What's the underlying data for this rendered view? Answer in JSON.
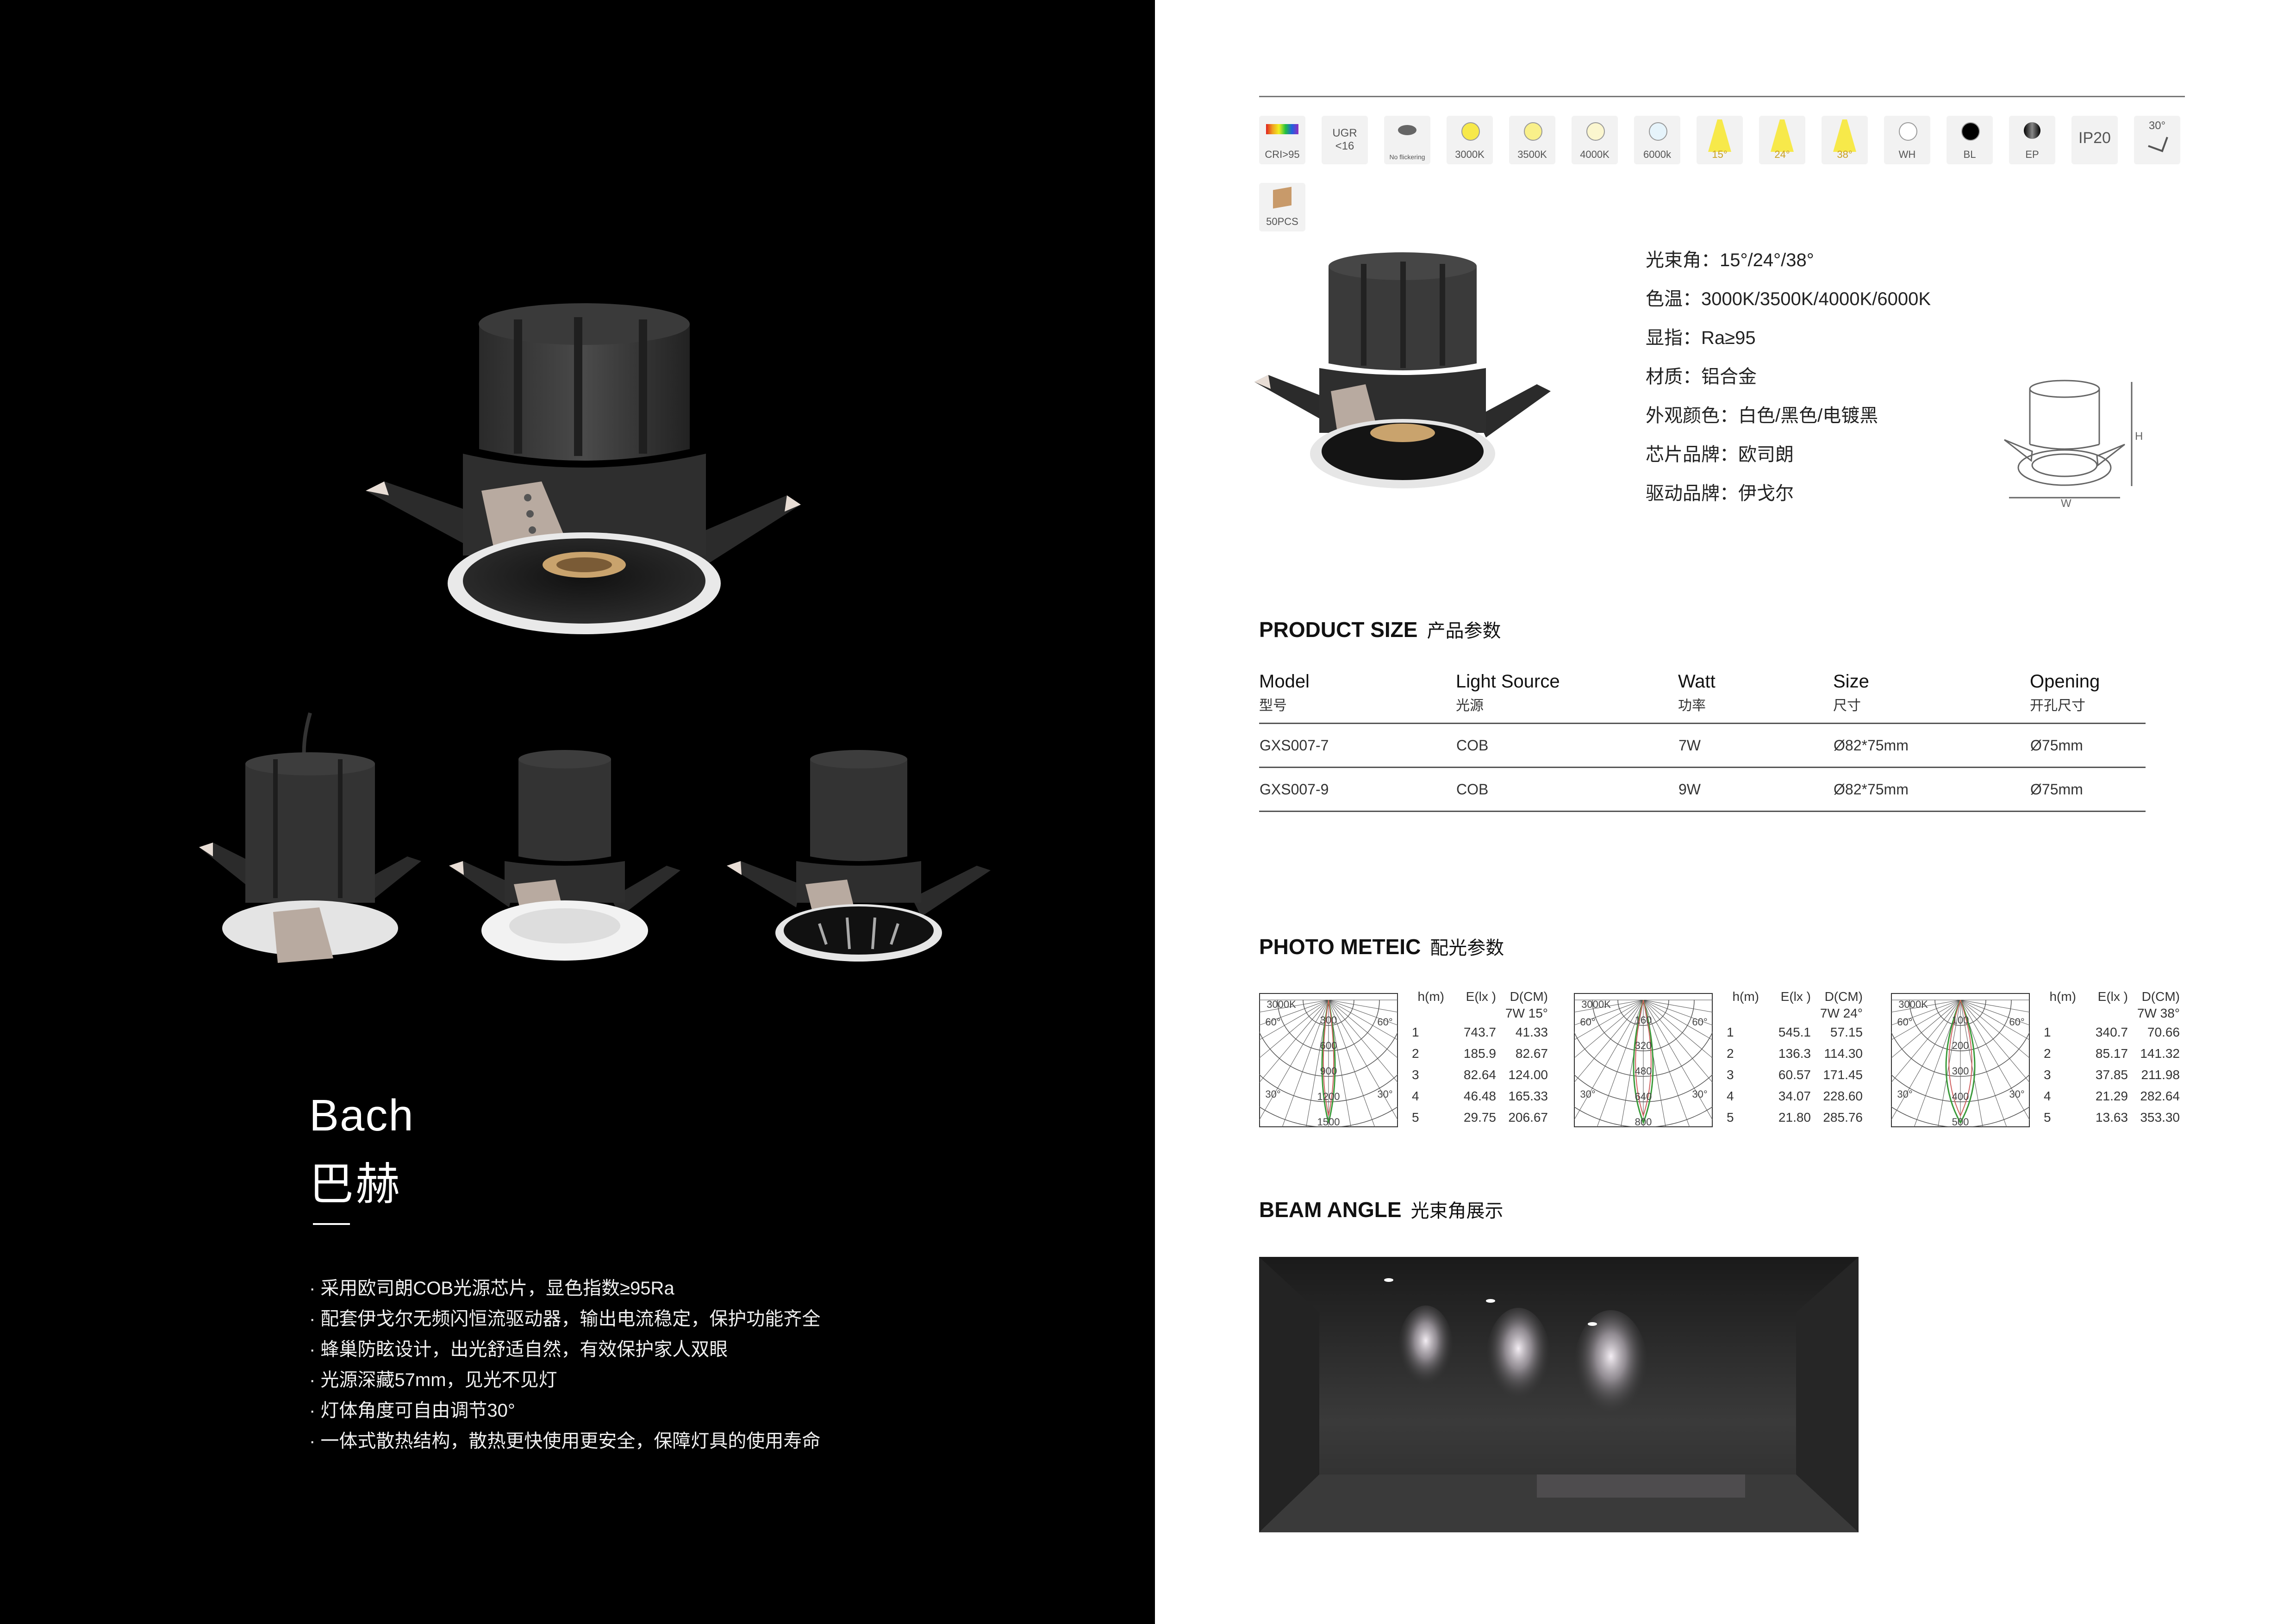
{
  "product": {
    "name_en": "Bach",
    "name_cn": "巴赫",
    "features": [
      "· 采用欧司朗COB光源芯片，显色指数≥95Ra",
      "· 配套伊戈尔无频闪恒流驱动器，输出电流稳定，保护功能齐全",
      "· 蜂巢防眩设计，出光舒适自然，有效保护家人双眼",
      "· 光源深藏57mm，见光不见灯",
      "· 灯体角度可自由调节30°",
      "· 一体式散热结构，散热更快使用更安全，保障灯具的使用寿命"
    ]
  },
  "icons": [
    {
      "name": "cri-icon",
      "label": "CRI>95",
      "type": "cri"
    },
    {
      "name": "ugr-icon",
      "label": "UGR\n<16",
      "type": "text"
    },
    {
      "name": "no-flicker-icon",
      "label": "No flickering",
      "type": "eye"
    },
    {
      "name": "cct-3000k-icon",
      "label": "3000K",
      "type": "dot",
      "color": "#f7e94a"
    },
    {
      "name": "cct-3500k-icon",
      "label": "3500K",
      "type": "dot",
      "color": "#f9f08a"
    },
    {
      "name": "cct-4000k-icon",
      "label": "4000K",
      "type": "dot",
      "color": "#fbf6cf"
    },
    {
      "name": "cct-6000k-icon",
      "label": "6000k",
      "type": "dot",
      "color": "#e6f4fb"
    },
    {
      "name": "beam-15-icon",
      "label": "15°",
      "type": "beam",
      "color": "#f7e94a"
    },
    {
      "name": "beam-24-icon",
      "label": "24°",
      "type": "beam",
      "color": "#f7e94a"
    },
    {
      "name": "beam-38-icon",
      "label": "38°",
      "type": "beam",
      "color": "#f7e94a"
    },
    {
      "name": "color-white-icon",
      "label": "WH",
      "type": "dot",
      "color": "#ffffff"
    },
    {
      "name": "color-black-icon",
      "label": "BL",
      "type": "dot",
      "color": "#000000"
    },
    {
      "name": "color-ep-icon",
      "label": "EP",
      "type": "ep"
    },
    {
      "name": "ip20-icon",
      "label": "IP20",
      "type": "text"
    },
    {
      "name": "tilt-30-icon",
      "label": "30°",
      "type": "tilt"
    },
    {
      "name": "box-50pcs-icon",
      "label": "50PCS",
      "type": "box"
    }
  ],
  "specs": [
    "光束角：15°/24°/38°",
    "色温：3000K/3500K/4000K/6000K",
    "显指：Ra≥95",
    "材质：铝合金",
    "外观颜色：白色/黑色/电镀黑",
    "芯片品牌：欧司朗",
    "驱动品牌：伊戈尔"
  ],
  "dimension_labels": {
    "height": "H",
    "width": "W"
  },
  "product_size": {
    "title": "PRODUCT SIZE",
    "title_cn": "产品参数",
    "columns": [
      {
        "en": "Model",
        "cn": "型号"
      },
      {
        "en": "Light Source",
        "cn": "光源"
      },
      {
        "en": "Watt",
        "cn": "功率"
      },
      {
        "en": "Size",
        "cn": "尺寸"
      },
      {
        "en": "Opening",
        "cn": "开孔尺寸"
      }
    ],
    "rows": [
      [
        "GXS007-7",
        "COB",
        "7W",
        "Ø82*75mm",
        "Ø75mm"
      ],
      [
        "GXS007-9",
        "COB",
        "9W",
        "Ø82*75mm",
        "Ø75mm"
      ]
    ]
  },
  "photometric": {
    "title": "PHOTO METEIC",
    "title_cn": "配光参数",
    "headers": [
      "h(m)",
      "E(lx )",
      "D(CM)"
    ],
    "diagrams": [
      {
        "cct": "3000K",
        "spec": "7W  15°",
        "rings": [
          "300",
          "600",
          "900",
          "1200",
          "1500"
        ],
        "angles": [
          "60°",
          "60°",
          "30°",
          "30°"
        ],
        "rows": [
          [
            "1",
            "743.7",
            "41.33"
          ],
          [
            "2",
            "185.9",
            "82.67"
          ],
          [
            "3",
            "82.64",
            "124.00"
          ],
          [
            "4",
            "46.48",
            "165.33"
          ],
          [
            "5",
            "29.75",
            "206.67"
          ]
        ]
      },
      {
        "cct": "3000K",
        "spec": "7W  24°",
        "rings": [
          "160",
          "320",
          "480",
          "640",
          "800"
        ],
        "angles": [
          "60°",
          "60°",
          "30°",
          "30°"
        ],
        "rows": [
          [
            "1",
            "545.1",
            "57.15"
          ],
          [
            "2",
            "136.3",
            "114.30"
          ],
          [
            "3",
            "60.57",
            "171.45"
          ],
          [
            "4",
            "34.07",
            "228.60"
          ],
          [
            "5",
            "21.80",
            "285.76"
          ]
        ]
      },
      {
        "cct": "3000K",
        "spec": "7W  38°",
        "rings": [
          "100",
          "200",
          "300",
          "400",
          "500"
        ],
        "angles": [
          "60°",
          "60°",
          "30°",
          "30°"
        ],
        "rows": [
          [
            "1",
            "340.7",
            "70.66"
          ],
          [
            "2",
            "85.17",
            "141.32"
          ],
          [
            "3",
            "37.85",
            "211.98"
          ],
          [
            "4",
            "21.29",
            "282.64"
          ],
          [
            "5",
            "13.63",
            "353.30"
          ]
        ]
      }
    ]
  },
  "beam_angle": {
    "title": "BEAM ANGLE",
    "title_cn": "光束角展示"
  }
}
